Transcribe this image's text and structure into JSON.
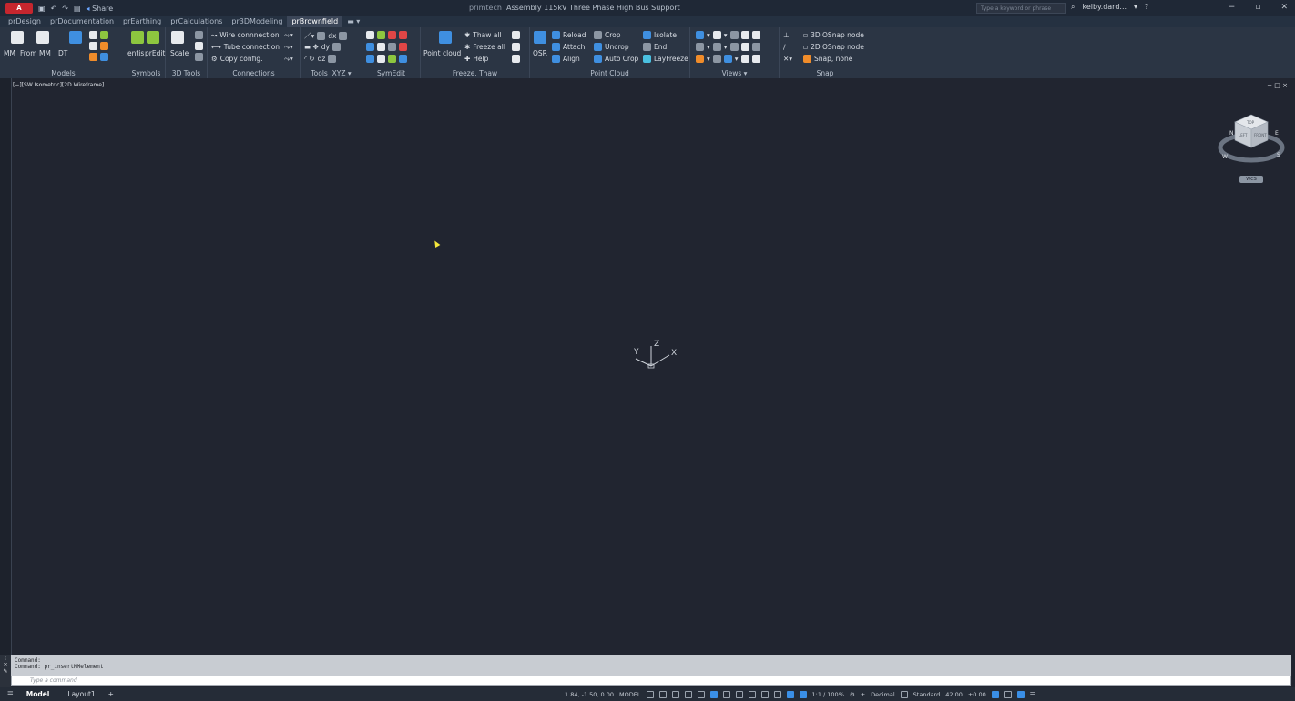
{
  "titlebar": {
    "app_menu": "A",
    "share": "Share",
    "app_name": "primtech",
    "doc_title": "Assembly 115kV Three Phase High Bus Support",
    "search_placeholder": "Type a keyword or phrase",
    "user": "kelby.dard..."
  },
  "tabs": [
    "prDesign",
    "prDocumentation",
    "prEarthing",
    "prCalculations",
    "pr3DModeling",
    "prBrownfield"
  ],
  "active_tab": "prBrownfield",
  "ribbon": {
    "models": {
      "title": "Models",
      "mm": "MM",
      "from_mm": "From MM",
      "dt": "DT"
    },
    "symbols": {
      "title": "Symbols",
      "entis": "entis",
      "predit": "prEdit"
    },
    "tools3d": {
      "title": "3D Tools",
      "scale": "Scale"
    },
    "connections": {
      "title": "Connections",
      "wire": "Wire connnection",
      "tube": "Tube connection",
      "copy": "Copy config."
    },
    "tools": {
      "title": "Tools",
      "xyz": "XYZ",
      "dx": "dx",
      "dy": "dy",
      "dz": "dz"
    },
    "symedit": {
      "title": "SymEdit"
    },
    "freeze": {
      "title": "Freeze, Thaw",
      "point_cloud": "Point cloud",
      "thaw_all": "Thaw all",
      "freeze_all": "Freeze all",
      "help": "Help"
    },
    "pointcloud": {
      "title": "Point Cloud",
      "osr": "OSR",
      "reload": "Reload",
      "attach": "Attach",
      "align": "Align",
      "crop": "Crop",
      "uncrop": "Uncrop",
      "auto_crop": "Auto Crop",
      "isolate": "Isolate",
      "end": "End",
      "layfreeze": "LayFreeze"
    },
    "views": {
      "title": "Views"
    },
    "snap": {
      "title": "Snap",
      "osnap3d": "3D OSnap node",
      "osnap2d": "2D OSnap node",
      "snap_none": "Snap, none"
    }
  },
  "viewport": {
    "label": "[−][SW Isometric][2D Wireframe]",
    "controls": "− □ ×",
    "wcs": "WCS",
    "ucs_x": "X",
    "ucs_y": "Y",
    "ucs_z": "Z",
    "compass": {
      "n": "N",
      "w": "W",
      "s": "S",
      "e": "E"
    },
    "cube_faces": [
      "TOP",
      "LEFT",
      "FRONT"
    ]
  },
  "command": {
    "line1": "Command:",
    "line2": "Command: pr_insertMMelement",
    "placeholder": "Type a command"
  },
  "statusbar": {
    "model_tab": "Model",
    "layout_tab": "Layout1",
    "coords": "1.84, -1.50, 0.00",
    "mode": "MODEL",
    "scale": "1:1 / 100%",
    "units": "Decimal",
    "style": "Standard",
    "angle": "42.00",
    "offset": "+0.00"
  },
  "colors": {
    "accent": "#3a8fe6",
    "app_red": "#c6262e",
    "canvas": "#212530"
  }
}
